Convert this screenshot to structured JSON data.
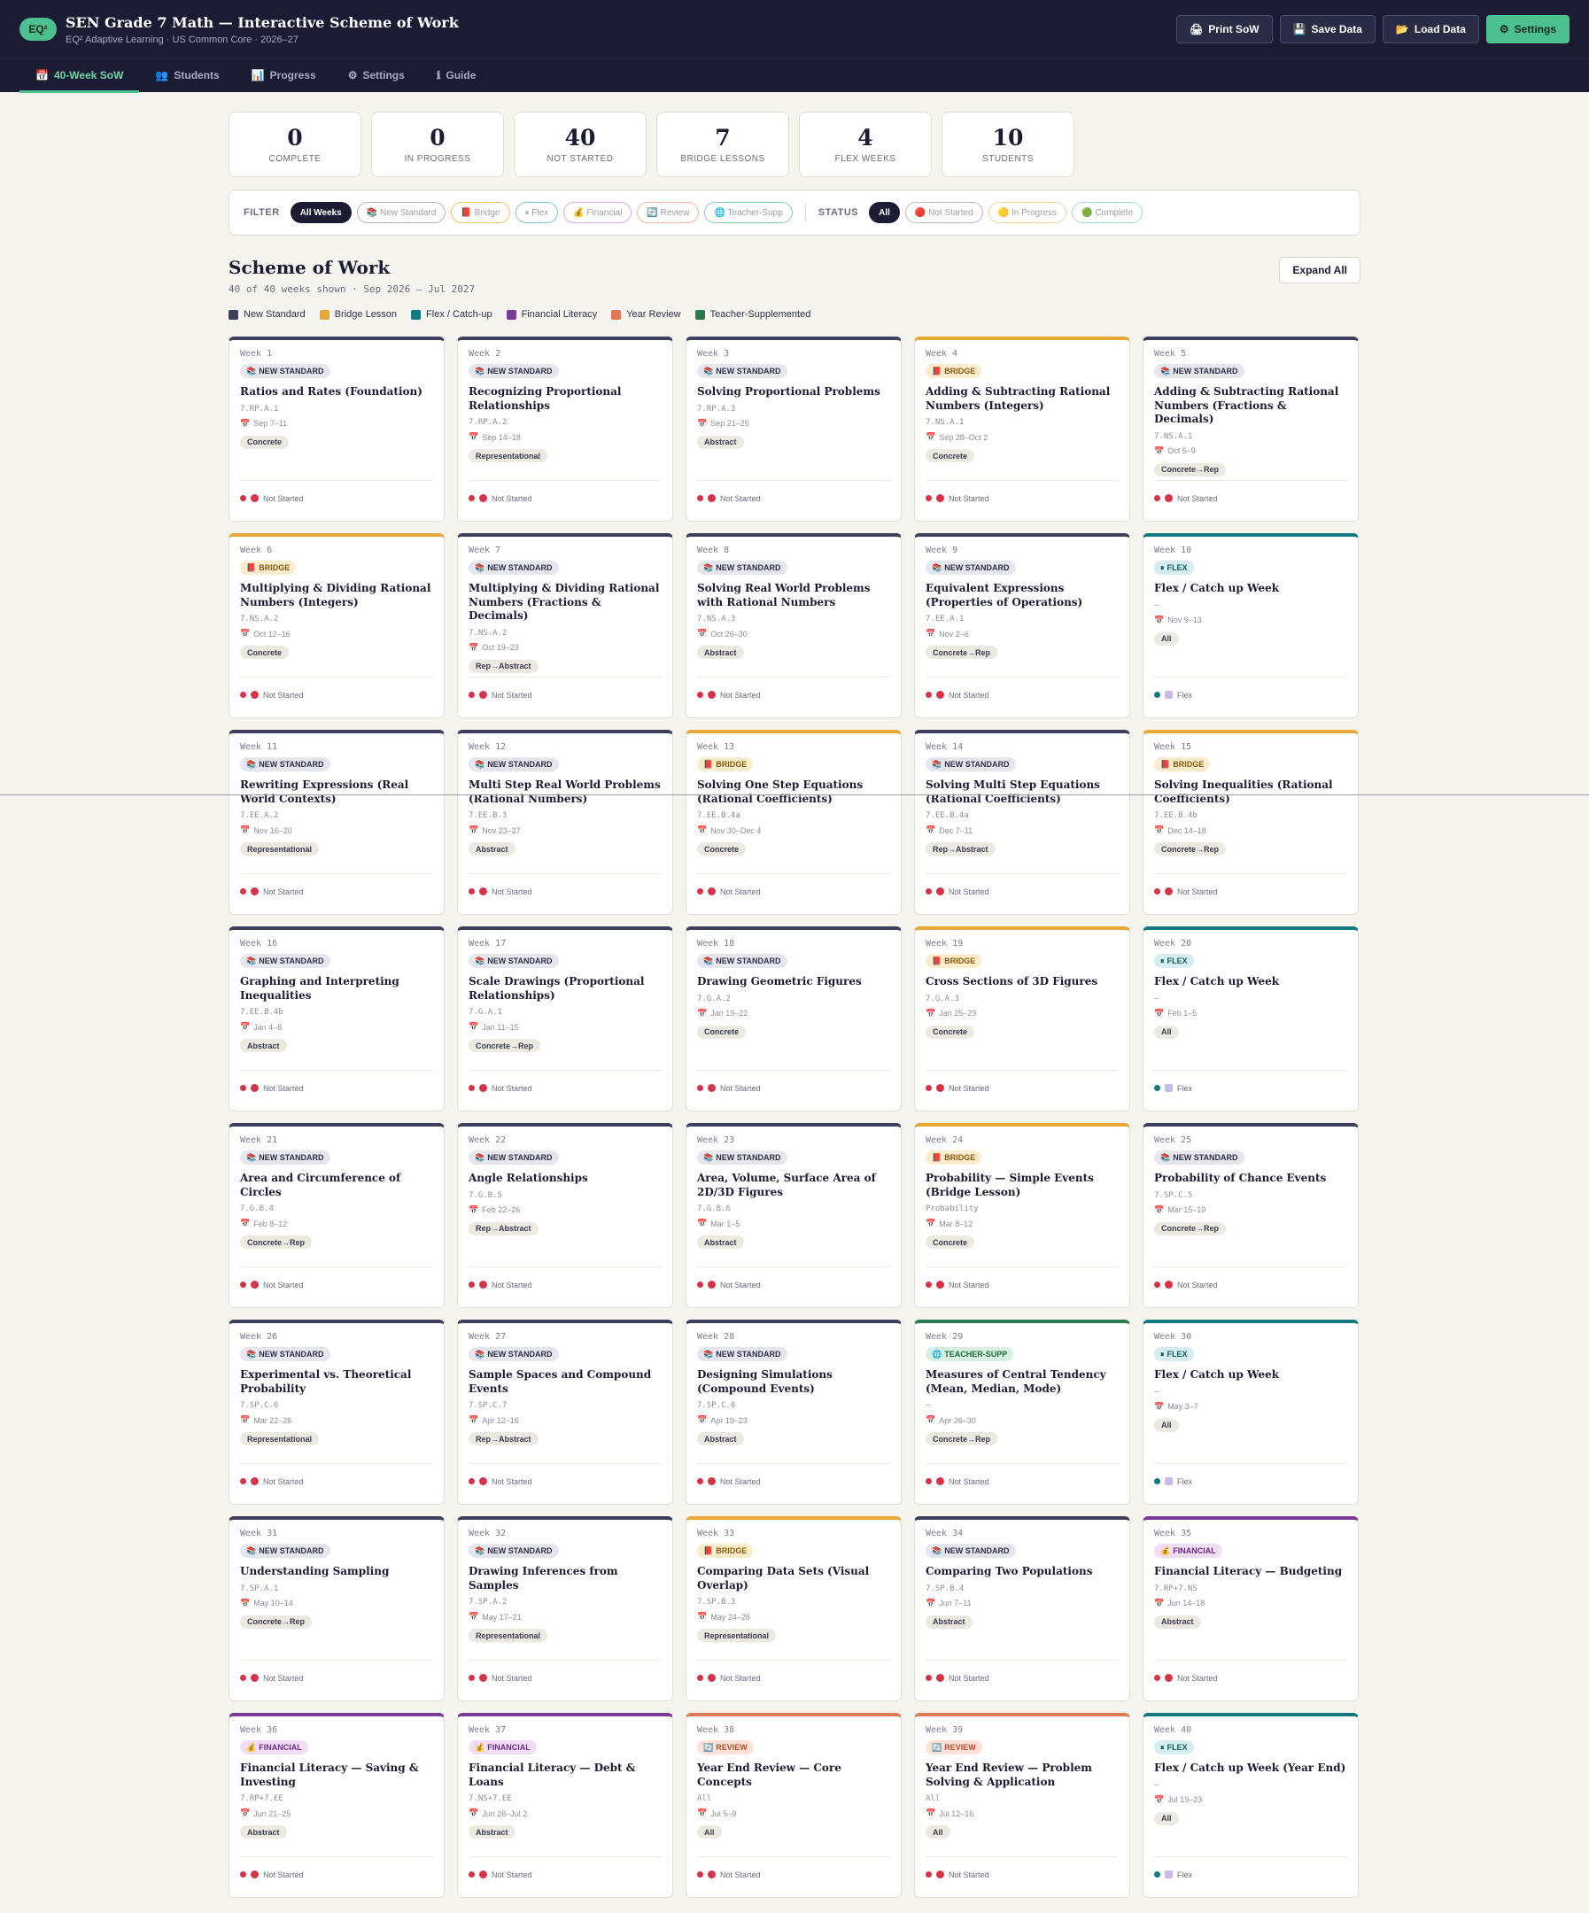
{
  "app": {
    "logo": "EQ²",
    "title": "SEN Grade 7 Math — Interactive Scheme of Work",
    "subtitle": "EQ² Adaptive Learning · US Common Core · 2026–27",
    "actions": [
      {
        "icon": "🖨",
        "label": "Print SoW"
      },
      {
        "icon": "💾",
        "label": "Save Data"
      },
      {
        "icon": "📂",
        "label": "Load Data"
      },
      {
        "icon": "⚙",
        "label": "Settings"
      }
    ]
  },
  "tabs": [
    {
      "icon": "📅",
      "label": "40-Week SoW"
    },
    {
      "icon": "👥",
      "label": "Students"
    },
    {
      "icon": "📊",
      "label": "Progress"
    },
    {
      "icon": "⚙",
      "label": "Settings"
    },
    {
      "icon": "ℹ",
      "label": "Guide"
    }
  ],
  "stats": [
    {
      "value": "0",
      "label": "COMPLETE"
    },
    {
      "value": "0",
      "label": "IN PROGRESS"
    },
    {
      "value": "40",
      "label": "NOT STARTED"
    },
    {
      "value": "7",
      "label": "BRIDGE LESSONS"
    },
    {
      "value": "4",
      "label": "FLEX WEEKS"
    },
    {
      "value": "10",
      "label": "STUDENTS"
    }
  ],
  "filter": {
    "label": "FILTER",
    "chips": [
      {
        "label": "All Weeks",
        "active": true,
        "color": "#1b1c33"
      },
      {
        "label": "📚 New Standard",
        "active": false,
        "color": "#b5b7c4"
      },
      {
        "label": "📕 Bridge",
        "active": false,
        "color": "#e8c46a"
      },
      {
        "label": "⏸ Flex",
        "active": false,
        "color": "#7ecbd2"
      },
      {
        "label": "💰 Financial",
        "active": false,
        "color": "#d9a9e0"
      },
      {
        "label": "🔄 Review",
        "active": false,
        "color": "#f1b8a4"
      },
      {
        "label": "🌐 Teacher-Supp",
        "active": false,
        "color": "#8fd2a8"
      }
    ],
    "status_label": "STATUS",
    "status_chips": [
      {
        "label": "All",
        "active": true,
        "color": "#1b1c33"
      },
      {
        "label": "🔴 Not Started",
        "active": false,
        "color": "#c4b5c8"
      },
      {
        "label": "🟡 In Progress",
        "active": false,
        "color": "#ecd79a"
      },
      {
        "label": "🟢 Complete",
        "active": false,
        "color": "#a8dcc4"
      }
    ]
  },
  "sow": {
    "title": "Scheme of Work",
    "subtitle": "40 of 40 weeks shown · Sep 2026 – Jul 2027",
    "expand_label": "Expand All"
  },
  "legend": [
    {
      "label": "New Standard",
      "color": "#3d3f5c"
    },
    {
      "label": "Bridge Lesson",
      "color": "#e8a838"
    },
    {
      "label": "Flex / Catch-up",
      "color": "#137a80"
    },
    {
      "label": "Financial Literacy",
      "color": "#7a3a96"
    },
    {
      "label": "Year Review",
      "color": "#e07a55"
    },
    {
      "label": "Teacher-Supplemented",
      "color": "#2e7a50"
    }
  ],
  "types": {
    "new": {
      "label": "NEW STANDARD",
      "icon": "📚",
      "border": "#3d3f5c",
      "bg": "#e6e6ee",
      "fg": "#2e3048"
    },
    "bridge": {
      "label": "BRIDGE",
      "icon": "📕",
      "border": "#e8a838",
      "bg": "#fbeccb",
      "fg": "#8a5a10"
    },
    "flex": {
      "label": "FLEX",
      "icon": "⏸",
      "border": "#137a80",
      "bg": "#d6eef0",
      "fg": "#0e5e63"
    },
    "financial": {
      "label": "FINANCIAL",
      "icon": "💰",
      "border": "#7a3a96",
      "bg": "#f1def5",
      "fg": "#6a2a86"
    },
    "review": {
      "label": "REVIEW",
      "icon": "🔄",
      "border": "#e07a55",
      "bg": "#fbe1d6",
      "fg": "#b0502e"
    },
    "teacher": {
      "label": "TEACHER-SUPP",
      "icon": "🌐",
      "border": "#2e7a50",
      "bg": "#d8f0e2",
      "fg": "#1e6a40"
    }
  },
  "weeks": [
    {
      "week": "Week 1",
      "type": "new",
      "title": "Ratios and Rates (Foundation)",
      "code": "7.RP.A.1",
      "dates": "Sep 7–11",
      "stage": "Concrete",
      "status": "Not Started"
    },
    {
      "week": "Week 2",
      "type": "new",
      "title": "Recognizing Proportional Relationships",
      "code": "7.RP.A.2",
      "dates": "Sep 14–18",
      "stage": "Representational",
      "status": "Not Started"
    },
    {
      "week": "Week 3",
      "type": "new",
      "title": "Solving Proportional Problems",
      "code": "7.RP.A.3",
      "dates": "Sep 21–25",
      "stage": "Abstract",
      "status": "Not Started"
    },
    {
      "week": "Week 4",
      "type": "bridge",
      "title": "Adding & Subtracting Rational Numbers (Integers)",
      "code": "7.NS.A.1",
      "dates": "Sep 28–Oct 2",
      "stage": "Concrete",
      "status": "Not Started"
    },
    {
      "week": "Week 5",
      "type": "new",
      "title": "Adding & Subtracting Rational Numbers (Fractions & Decimals)",
      "code": "7.NS.A.1",
      "dates": "Oct 5–9",
      "stage": "Concrete→Rep",
      "status": "Not Started"
    },
    {
      "week": "Week 6",
      "type": "bridge",
      "title": "Multiplying & Dividing Rational Numbers (Integers)",
      "code": "7.NS.A.2",
      "dates": "Oct 12–16",
      "stage": "Concrete",
      "status": "Not Started"
    },
    {
      "week": "Week 7",
      "type": "new",
      "title": "Multiplying & Dividing Rational Numbers (Fractions & Decimals)",
      "code": "7.NS.A.2",
      "dates": "Oct 19–23",
      "stage": "Rep→Abstract",
      "status": "Not Started"
    },
    {
      "week": "Week 8",
      "type": "new",
      "title": "Solving Real World Problems with Rational Numbers",
      "code": "7.NS.A.3",
      "dates": "Oct 26–30",
      "stage": "Abstract",
      "status": "Not Started"
    },
    {
      "week": "Week 9",
      "type": "new",
      "title": "Equivalent Expressions (Properties of Operations)",
      "code": "7.EE.A.1",
      "dates": "Nov 2–6",
      "stage": "Concrete→Rep",
      "status": "Not Started"
    },
    {
      "week": "Week 10",
      "type": "flex",
      "title": "Flex / Catch up Week",
      "code": "–",
      "dates": "Nov 9–13",
      "stage": "All",
      "status": "Flex"
    },
    {
      "week": "Week 11",
      "type": "new",
      "title": "Rewriting Expressions (Real World Contexts)",
      "code": "7.EE.A.2",
      "dates": "Nov 16–20",
      "stage": "Representational",
      "status": "Not Started"
    },
    {
      "week": "Week 12",
      "type": "new",
      "title": "Multi Step Real World Problems (Rational Numbers)",
      "code": "7.EE.B.3",
      "dates": "Nov 23–27",
      "stage": "Abstract",
      "status": "Not Started"
    },
    {
      "week": "Week 13",
      "type": "bridge",
      "title": "Solving One Step Equations (Rational Coefficients)",
      "code": "7.EE.B.4a",
      "dates": "Nov 30–Dec 4",
      "stage": "Concrete",
      "status": "Not Started"
    },
    {
      "week": "Week 14",
      "type": "new",
      "title": "Solving Multi Step Equations (Rational Coefficients)",
      "code": "7.EE.B.4a",
      "dates": "Dec 7–11",
      "stage": "Rep→Abstract",
      "status": "Not Started"
    },
    {
      "week": "Week 15",
      "type": "bridge",
      "title": "Solving Inequalities (Rational Coefficients)",
      "code": "7.EE.B.4b",
      "dates": "Dec 14–18",
      "stage": "Concrete→Rep",
      "status": "Not Started"
    },
    {
      "week": "Week 16",
      "type": "new",
      "title": "Graphing and Interpreting Inequalities",
      "code": "7.EE.B.4b",
      "dates": "Jan 4–8",
      "stage": "Abstract",
      "status": "Not Started"
    },
    {
      "week": "Week 17",
      "type": "new",
      "title": "Scale Drawings (Proportional Relationships)",
      "code": "7.G.A.1",
      "dates": "Jan 11–15",
      "stage": "Concrete→Rep",
      "status": "Not Started"
    },
    {
      "week": "Week 18",
      "type": "new",
      "title": "Drawing Geometric Figures",
      "code": "7.G.A.2",
      "dates": "Jan 19–22",
      "stage": "Concrete",
      "status": "Not Started"
    },
    {
      "week": "Week 19",
      "type": "bridge",
      "title": "Cross Sections of 3D Figures",
      "code": "7.G.A.3",
      "dates": "Jan 25–29",
      "stage": "Concrete",
      "status": "Not Started"
    },
    {
      "week": "Week 20",
      "type": "flex",
      "title": "Flex / Catch up Week",
      "code": "–",
      "dates": "Feb 1–5",
      "stage": "All",
      "status": "Flex"
    },
    {
      "week": "Week 21",
      "type": "new",
      "title": "Area and Circumference of Circles",
      "code": "7.G.B.4",
      "dates": "Feb 8–12",
      "stage": "Concrete→Rep",
      "status": "Not Started"
    },
    {
      "week": "Week 22",
      "type": "new",
      "title": "Angle Relationships",
      "code": "7.G.B.5",
      "dates": "Feb 22–26",
      "stage": "Rep→Abstract",
      "status": "Not Started"
    },
    {
      "week": "Week 23",
      "type": "new",
      "title": "Area, Volume, Surface Area of 2D/3D Figures",
      "code": "7.G.B.6",
      "dates": "Mar 1–5",
      "stage": "Abstract",
      "status": "Not Started"
    },
    {
      "week": "Week 24",
      "type": "bridge",
      "title": "Probability — Simple Events (Bridge Lesson)",
      "code": "Probability",
      "dates": "Mar 8–12",
      "stage": "Concrete",
      "status": "Not Started"
    },
    {
      "week": "Week 25",
      "type": "new",
      "title": "Probability of Chance Events",
      "code": "7.SP.C.5",
      "dates": "Mar 15–19",
      "stage": "Concrete→Rep",
      "status": "Not Started"
    },
    {
      "week": "Week 26",
      "type": "new",
      "title": "Experimental vs. Theoretical Probability",
      "code": "7.SP.C.6",
      "dates": "Mar 22–26",
      "stage": "Representational",
      "status": "Not Started"
    },
    {
      "week": "Week 27",
      "type": "new",
      "title": "Sample Spaces and Compound Events",
      "code": "7.SP.C.7",
      "dates": "Apr 12–16",
      "stage": "Rep→Abstract",
      "status": "Not Started"
    },
    {
      "week": "Week 28",
      "type": "new",
      "title": "Designing Simulations (Compound Events)",
      "code": "7.SP.C.8",
      "dates": "Apr 19–23",
      "stage": "Abstract",
      "status": "Not Started"
    },
    {
      "week": "Week 29",
      "type": "teacher",
      "title": "Measures of Central Tendency (Mean, Median, Mode)",
      "code": "–",
      "dates": "Apr 26–30",
      "stage": "Concrete→Rep",
      "status": "Not Started"
    },
    {
      "week": "Week 30",
      "type": "flex",
      "title": "Flex / Catch up Week",
      "code": "–",
      "dates": "May 3–7",
      "stage": "All",
      "status": "Flex"
    },
    {
      "week": "Week 31",
      "type": "new",
      "title": "Understanding Sampling",
      "code": "7.SP.A.1",
      "dates": "May 10–14",
      "stage": "Concrete→Rep",
      "status": "Not Started"
    },
    {
      "week": "Week 32",
      "type": "new",
      "title": "Drawing Inferences from Samples",
      "code": "7.SP.A.2",
      "dates": "May 17–21",
      "stage": "Representational",
      "status": "Not Started"
    },
    {
      "week": "Week 33",
      "type": "bridge",
      "title": "Comparing Data Sets (Visual Overlap)",
      "code": "7.SP.B.3",
      "dates": "May 24–28",
      "stage": "Representational",
      "status": "Not Started"
    },
    {
      "week": "Week 34",
      "type": "new",
      "title": "Comparing Two Populations",
      "code": "7.SP.B.4",
      "dates": "Jun 7–11",
      "stage": "Abstract",
      "status": "Not Started"
    },
    {
      "week": "Week 35",
      "type": "financial",
      "title": "Financial Literacy — Budgeting",
      "code": "7.RP+7.NS",
      "dates": "Jun 14–18",
      "stage": "Abstract",
      "status": "Not Started"
    },
    {
      "week": "Week 36",
      "type": "financial",
      "title": "Financial Literacy — Saving & Investing",
      "code": "7.RP+7.EE",
      "dates": "Jun 21–25",
      "stage": "Abstract",
      "status": "Not Started"
    },
    {
      "week": "Week 37",
      "type": "financial",
      "title": "Financial Literacy — Debt & Loans",
      "code": "7.NS+7.EE",
      "dates": "Jun 28–Jul 2",
      "stage": "Abstract",
      "status": "Not Started"
    },
    {
      "week": "Week 38",
      "type": "review",
      "title": "Year End Review — Core Concepts",
      "code": "All",
      "dates": "Jul 5–9",
      "stage": "All",
      "status": "Not Started"
    },
    {
      "week": "Week 39",
      "type": "review",
      "title": "Year End Review — Problem Solving & Application",
      "code": "All",
      "dates": "Jul 12–16",
      "stage": "All",
      "status": "Not Started"
    },
    {
      "week": "Week 40",
      "type": "flex",
      "title": "Flex / Catch up Week (Year End)",
      "code": "–",
      "dates": "Jul 19–23",
      "stage": "All",
      "status": "Flex"
    }
  ]
}
